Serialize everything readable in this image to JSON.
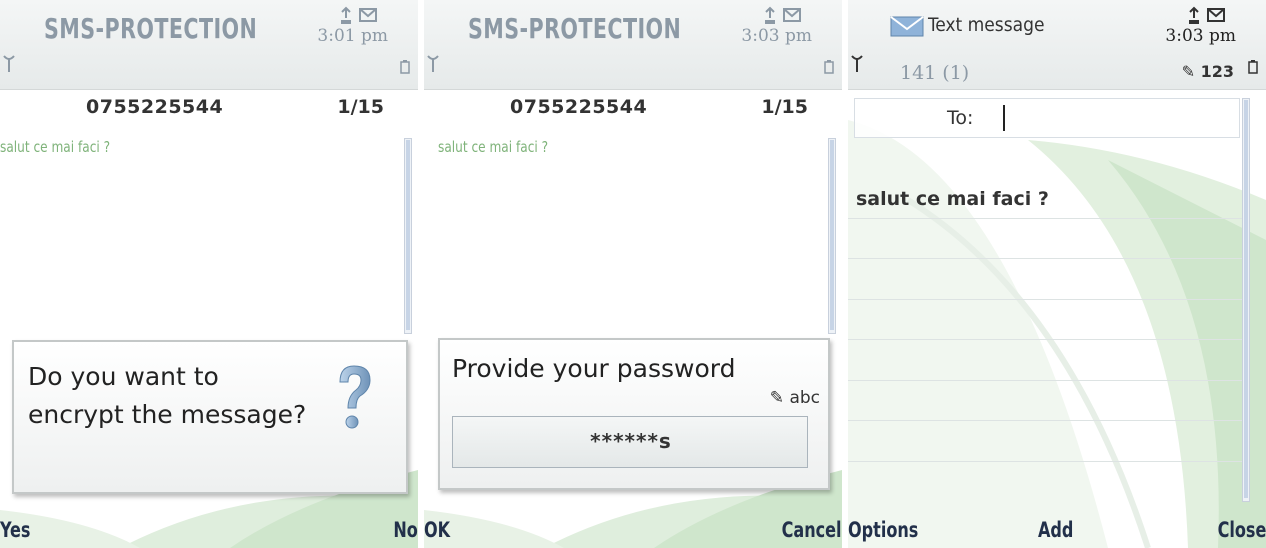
{
  "screens": [
    {
      "header": {
        "app_title": "SMS-PROTECTION",
        "clock": "3:01 pm"
      },
      "message": {
        "number": "0755225544",
        "counter": "1/15",
        "body": "salut ce mai faci ?"
      },
      "dialog": {
        "text": "Do you want to encrypt the message?",
        "icon": "question-mark-icon"
      },
      "softkeys": {
        "left": "Yes",
        "right": "No"
      }
    },
    {
      "header": {
        "app_title": "SMS-PROTECTION",
        "clock": "3:03 pm"
      },
      "message": {
        "number": "0755225544",
        "counter": "1/15",
        "body": "salut ce mai faci ?"
      },
      "dialog": {
        "prompt": "Provide your password",
        "input_mode": "abc",
        "password_value": "******s"
      },
      "softkeys": {
        "left": "OK",
        "right": "Cancel"
      }
    },
    {
      "header": {
        "title": "Text message",
        "clock": "3:03 pm",
        "info_left": "141 (1)",
        "info_right": "123"
      },
      "compose": {
        "to_label": "To:",
        "body": "salut ce mai faci ?"
      },
      "softkeys": {
        "left": "Options",
        "center": "Add",
        "right": "Close"
      }
    }
  ],
  "colors": {
    "title_gray": "#8c99a5",
    "message_green": "#7fb37a",
    "softkey_text": "#22304a"
  }
}
